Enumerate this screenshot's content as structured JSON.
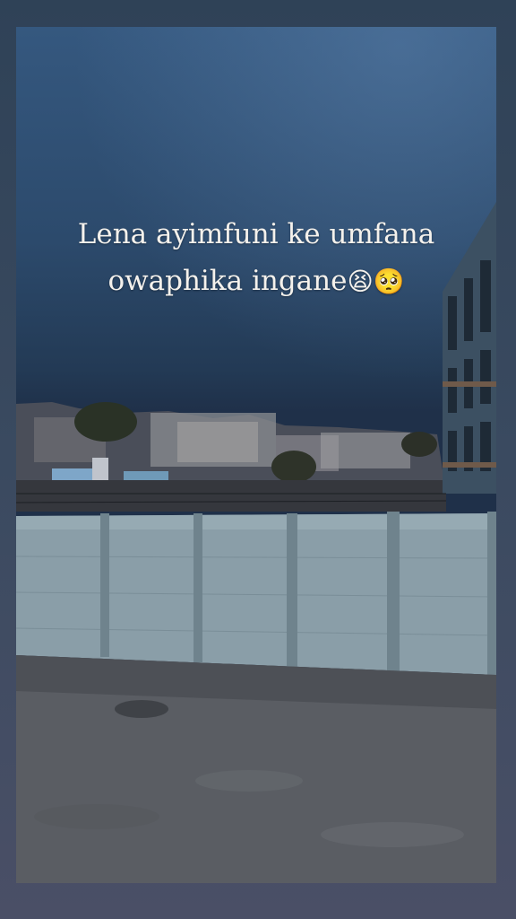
{
  "story": {
    "caption_line1": "Lena ayimfuni ke umfana",
    "caption_line2": "owaphika ingane",
    "emojis": [
      "😫",
      "🥺"
    ]
  }
}
